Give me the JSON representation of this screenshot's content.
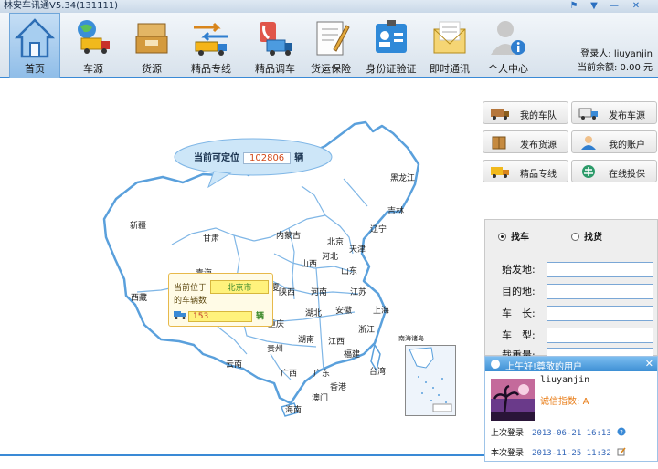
{
  "window": {
    "title": "林安车讯通V5.34(131111)"
  },
  "nav": {
    "items": [
      {
        "label": "首页",
        "icon": "home-icon"
      },
      {
        "label": "车源",
        "icon": "truck-globe-icon"
      },
      {
        "label": "货源",
        "icon": "cargo-box-icon"
      },
      {
        "label": "精品专线",
        "icon": "route-truck-icon"
      },
      {
        "label": "精品调车",
        "icon": "phone-truck-icon"
      },
      {
        "label": "货运保险",
        "icon": "insurance-doc-icon"
      },
      {
        "label": "身份证验证",
        "icon": "id-card-icon"
      },
      {
        "label": "即时通讯",
        "icon": "mail-icon"
      },
      {
        "label": "个人中心",
        "icon": "user-info-icon"
      }
    ]
  },
  "user": {
    "login_label": "登录人:",
    "login_name": "liuyanjin",
    "balance_label": "当前余额:",
    "balance": "0.00 元"
  },
  "map": {
    "bubble": {
      "prefix": "当前可定位",
      "count": "102806",
      "unit": "辆"
    },
    "provinces": [
      "黑龙江",
      "吉林",
      "辽宁",
      "内蒙古",
      "北京",
      "天津",
      "河北",
      "山西",
      "山东",
      "新疆",
      "甘肃",
      "青海",
      "宁夏",
      "陕西",
      "河南",
      "江苏",
      "上海",
      "安徽",
      "湖北",
      "浙江",
      "西藏",
      "四川",
      "重庆",
      "湖南",
      "江西",
      "贵州",
      "福建",
      "云南",
      "广西",
      "广东",
      "台湾",
      "香港",
      "澳门",
      "海南",
      "南海诸岛"
    ],
    "popup": {
      "located_label": "当前位于",
      "city": "北京市",
      "count_label": "的车辆数",
      "count": "153",
      "unit": "辆"
    }
  },
  "actions": [
    {
      "label": "我的车队",
      "icon": "fleet-icon"
    },
    {
      "label": "发布车源",
      "icon": "truck-icon"
    },
    {
      "label": "发布货源",
      "icon": "box-icon"
    },
    {
      "label": "我的账户",
      "icon": "account-icon"
    },
    {
      "label": "精品专线",
      "icon": "express-truck-icon"
    },
    {
      "label": "在线投保",
      "icon": "insurance-icon"
    }
  ],
  "search": {
    "find_car": "找车",
    "find_cargo": "找货",
    "fields": [
      {
        "label": "始发地:",
        "value": ""
      },
      {
        "label": "目的地:",
        "value": ""
      },
      {
        "label": "车　长:",
        "value": ""
      },
      {
        "label": "车　型:",
        "value": ""
      },
      {
        "label": "载重量:",
        "value": ""
      }
    ]
  },
  "welcome": {
    "header": "上午好!尊敬的用户",
    "close": "✕",
    "username": "liuyanjin",
    "credit_label": "诚信指数:",
    "credit_value": "A",
    "last_login_label": "上次登录:",
    "last_login": "2013-06-21 16:13",
    "this_login_label": "本次登录:",
    "this_login": "2013-11-25 11:32"
  },
  "colors": {
    "accent": "#3a8ad6",
    "map_stroke": "#5aa0dc",
    "bubble_fill": "#cde6f8",
    "popup_fill": "#fffbe6",
    "count_color": "#d24a1b"
  }
}
